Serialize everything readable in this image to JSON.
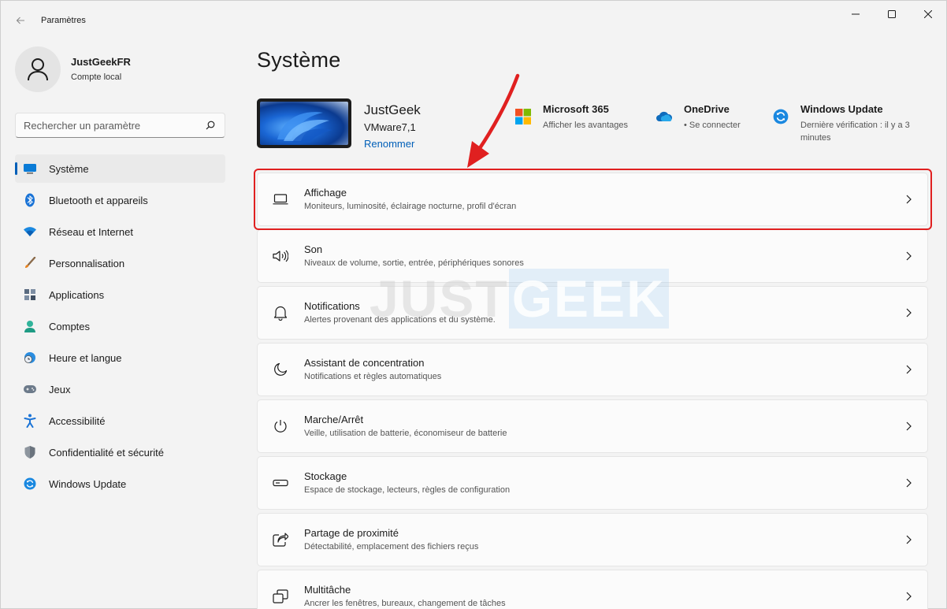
{
  "window": {
    "title": "Paramètres"
  },
  "profile": {
    "name": "JustGeekFR",
    "account_type": "Compte local"
  },
  "search": {
    "placeholder": "Rechercher un paramètre"
  },
  "sidebar": {
    "items": [
      {
        "label": "Système",
        "icon": "monitor-icon",
        "active": true
      },
      {
        "label": "Bluetooth et appareils",
        "icon": "bluetooth-icon"
      },
      {
        "label": "Réseau et Internet",
        "icon": "wifi-icon"
      },
      {
        "label": "Personnalisation",
        "icon": "brush-icon"
      },
      {
        "label": "Applications",
        "icon": "apps-icon"
      },
      {
        "label": "Comptes",
        "icon": "person-icon"
      },
      {
        "label": "Heure et langue",
        "icon": "globe-clock-icon"
      },
      {
        "label": "Jeux",
        "icon": "gamepad-icon"
      },
      {
        "label": "Accessibilité",
        "icon": "accessibility-icon"
      },
      {
        "label": "Confidentialité et sécurité",
        "icon": "shield-icon"
      },
      {
        "label": "Windows Update",
        "icon": "update-icon"
      }
    ]
  },
  "main": {
    "title": "Système",
    "device": {
      "name": "JustGeek",
      "model": "VMware7,1",
      "rename_label": "Renommer"
    },
    "quick_links": [
      {
        "title": "Microsoft 365",
        "subtitle": "Afficher les avantages",
        "icon": "microsoft-logo-icon"
      },
      {
        "title": "OneDrive",
        "subtitle": "• Se connecter",
        "icon": "onedrive-cloud-icon"
      },
      {
        "title": "Windows Update",
        "subtitle_line1": "Dernière vérification : il y a 3",
        "subtitle_line2": "minutes",
        "icon": "update-icon"
      }
    ],
    "cards": [
      {
        "title": "Affichage",
        "subtitle": "Moniteurs, luminosité, éclairage nocturne, profil d'écran",
        "icon": "display-icon"
      },
      {
        "title": "Son",
        "subtitle": "Niveaux de volume, sortie, entrée, périphériques sonores",
        "icon": "speaker-icon"
      },
      {
        "title": "Notifications",
        "subtitle": "Alertes provenant des applications et du système.",
        "icon": "bell-icon"
      },
      {
        "title": "Assistant de concentration",
        "subtitle": "Notifications et règles automatiques",
        "icon": "moon-icon"
      },
      {
        "title": "Marche/Arrêt",
        "subtitle": "Veille, utilisation de batterie, économiseur de batterie",
        "icon": "power-icon"
      },
      {
        "title": "Stockage",
        "subtitle": "Espace de stockage, lecteurs, règles de configuration",
        "icon": "storage-drive-icon"
      },
      {
        "title": "Partage de proximité",
        "subtitle": "Détectabilité, emplacement des fichiers reçus",
        "icon": "share-icon"
      },
      {
        "title": "Multitâche",
        "subtitle": "Ancrer les fenêtres, bureaux, changement de tâches",
        "icon": "multitask-icon"
      }
    ]
  },
  "watermark": {
    "part1": "JUST",
    "part2": "GEEK"
  },
  "colors": {
    "accent": "#005fb8",
    "highlight": "#e02020",
    "background": "#f3f3f3",
    "card": "#fbfbfb"
  }
}
